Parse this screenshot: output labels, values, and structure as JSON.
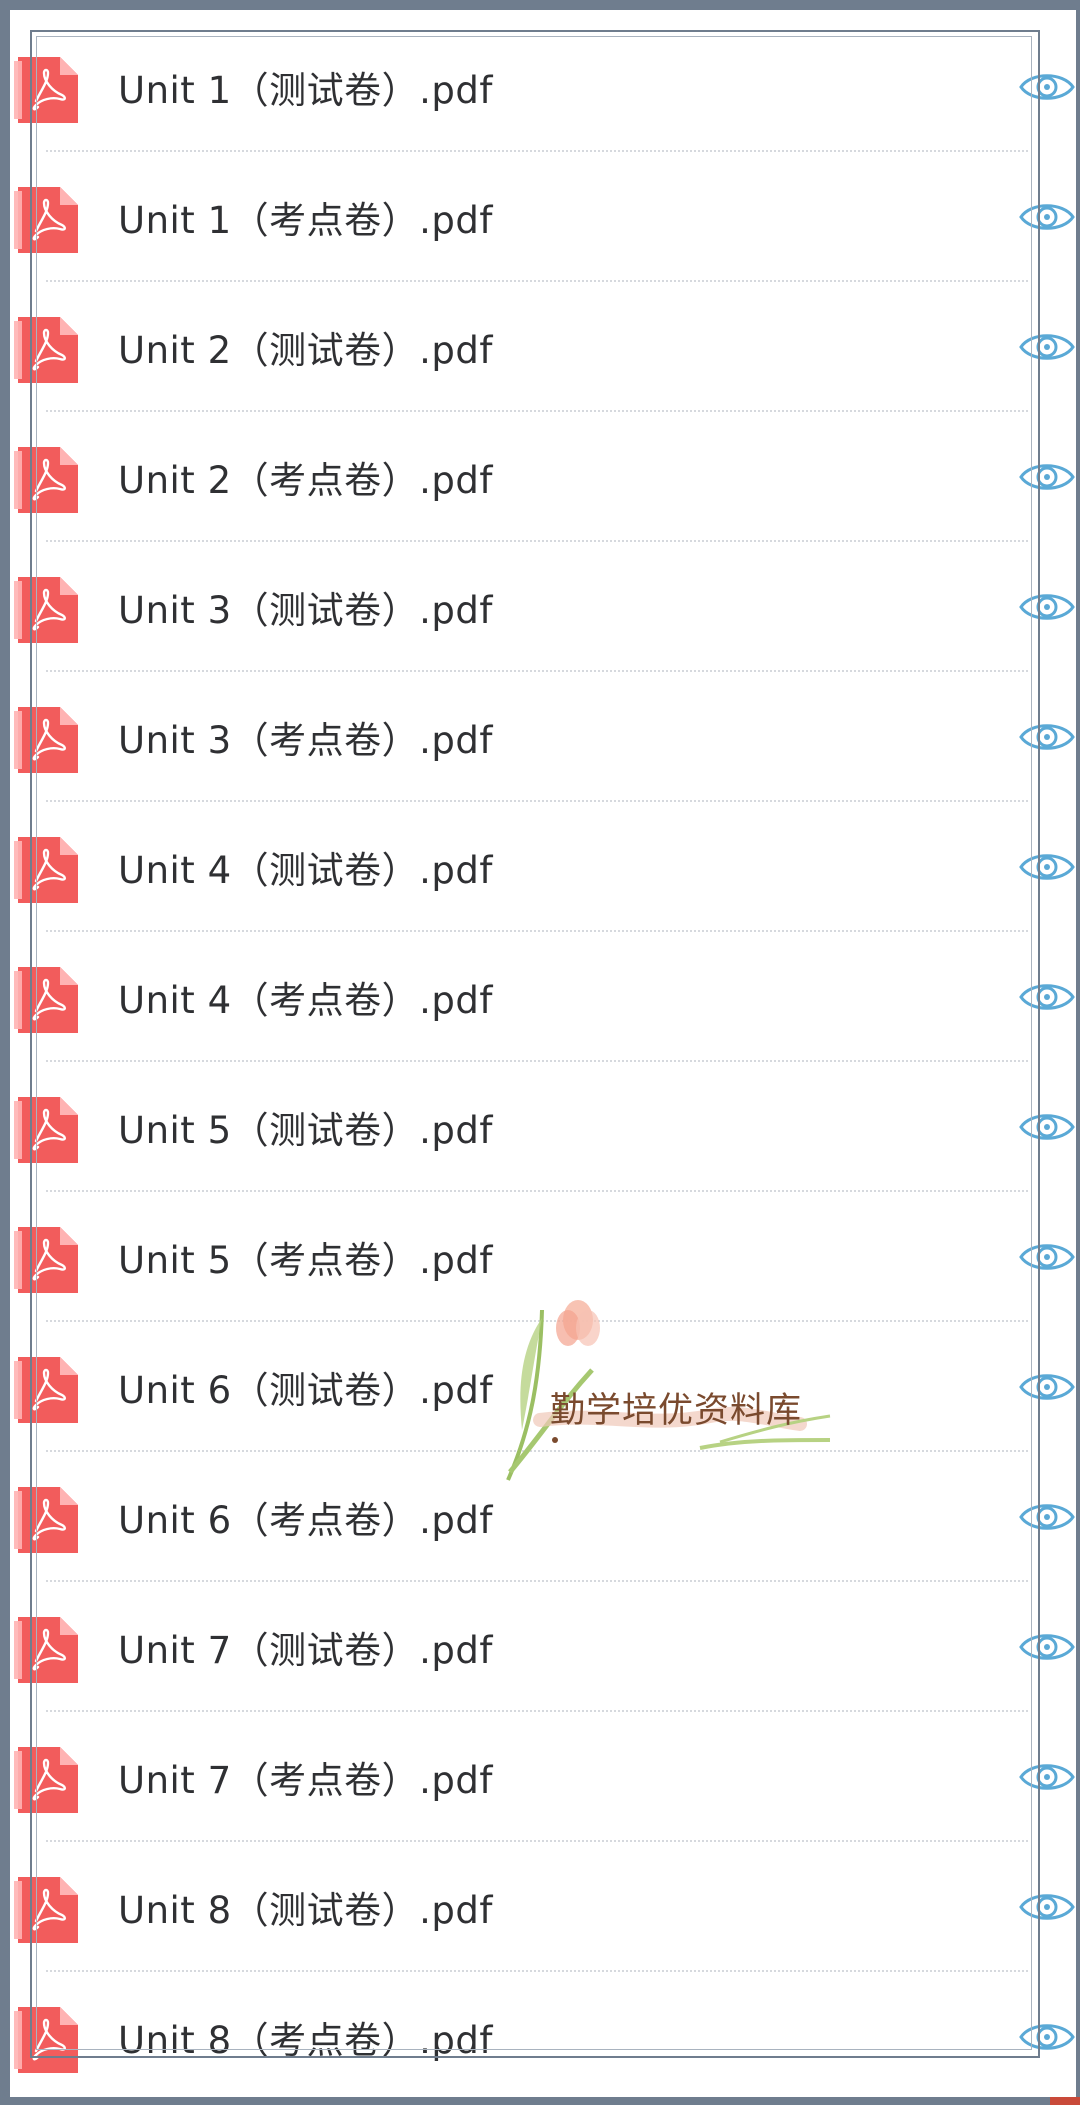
{
  "files": [
    {
      "name": "Unit 1（测试卷）.pdf"
    },
    {
      "name": "Unit 1（考点卷）.pdf"
    },
    {
      "name": "Unit 2（测试卷）.pdf"
    },
    {
      "name": "Unit 2（考点卷）.pdf"
    },
    {
      "name": "Unit 3（测试卷）.pdf"
    },
    {
      "name": "Unit 3（考点卷）.pdf"
    },
    {
      "name": "Unit 4（测试卷）.pdf"
    },
    {
      "name": "Unit 4（考点卷）.pdf"
    },
    {
      "name": "Unit 5（测试卷）.pdf"
    },
    {
      "name": "Unit 5（考点卷）.pdf"
    },
    {
      "name": "Unit 6（测试卷）.pdf"
    },
    {
      "name": "Unit 6（考点卷）.pdf"
    },
    {
      "name": "Unit 7（测试卷）.pdf"
    },
    {
      "name": "Unit 7（考点卷）.pdf"
    },
    {
      "name": "Unit 8（测试卷）.pdf"
    },
    {
      "name": "Unit 8（考点卷）.pdf"
    }
  ],
  "icons": {
    "file": "pdf-file-icon",
    "action": "eye-preview-icon"
  },
  "watermark": {
    "text": "勤学培优资料库"
  },
  "colors": {
    "pdf_icon": "#f25c5c",
    "pdf_icon_fold": "#ffb3b3",
    "eye_icon": "#5aa9d6",
    "frame": "#6f7d8e",
    "text": "#2f3033"
  }
}
